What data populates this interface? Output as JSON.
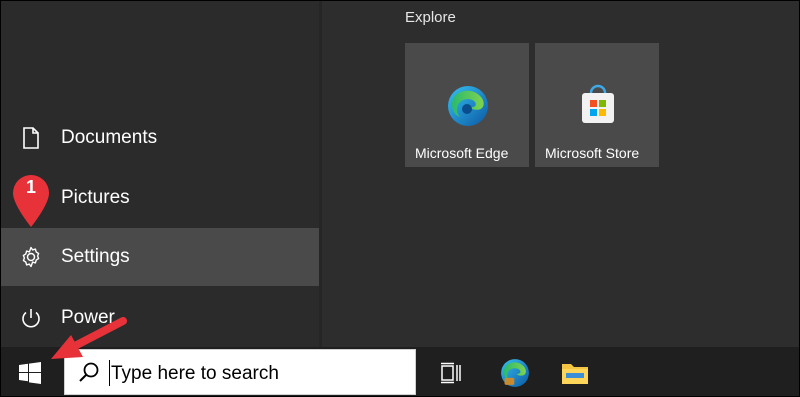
{
  "start_menu": {
    "nav_items": [
      {
        "label": "Documents",
        "icon": "document-icon"
      },
      {
        "label": "Pictures",
        "icon": "pictures-icon"
      },
      {
        "label": "Settings",
        "icon": "gear-icon",
        "selected": true
      },
      {
        "label": "Power",
        "icon": "power-icon"
      }
    ],
    "explore": {
      "heading": "Explore",
      "tiles": [
        {
          "label": "Microsoft Edge",
          "icon": "edge-icon"
        },
        {
          "label": "Microsoft Store",
          "icon": "store-icon"
        }
      ]
    }
  },
  "taskbar": {
    "start_icon": "windows-logo-icon",
    "search": {
      "placeholder": "Type here to search",
      "icon": "search-icon"
    },
    "pinned": [
      {
        "icon": "task-view-icon"
      },
      {
        "icon": "edge-icon"
      },
      {
        "icon": "file-explorer-icon"
      }
    ]
  },
  "annotation": {
    "step_number": "1",
    "accent_color": "#e8323a"
  },
  "colors": {
    "selected_item": "#4a4a4a",
    "tile_bg": "#4a4a4a",
    "menu_bg": "#2b2b2b",
    "taskbar_bg": "#1f1f1f"
  }
}
